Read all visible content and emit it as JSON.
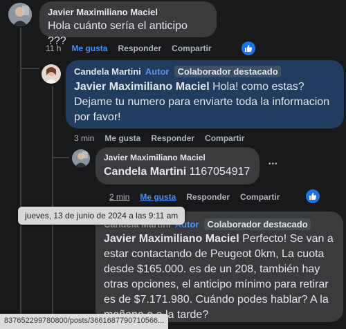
{
  "comments": [
    {
      "author": "Javier Maximiliano Maciel",
      "text": "Hola cuánto sería el anticipo ???",
      "time": "11 h",
      "like": "Me gusta",
      "reply": "Responder",
      "share": "Compartir"
    },
    {
      "author": "Candela Martini",
      "author_badge": "Autor",
      "collab_badge": "Colaborador destacado",
      "mention": "Javier Maximiliano Maciel",
      "text": " Hola! como estas? Dejame tu numero para enviarte toda la informacion por favor!",
      "time": "3 min",
      "like": "Me gusta",
      "reply": "Responder",
      "share": "Compartir"
    },
    {
      "author": "Javier Maximiliano Maciel",
      "mention": "Candela Martini",
      "text": " 1167054917",
      "more": "•••",
      "time": "2 min",
      "like": "Me gusta",
      "reply": "Responder",
      "share": "Compartir"
    },
    {
      "author": "Candela Martini",
      "author_badge": "Autor",
      "collab_badge": "Colaborador destacado",
      "mention": "Javier Maximiliano Maciel",
      "text": " Perfecto! Se van a estar contactando de Peugeot 0km, La cuota desde $165.000. es de un 208, también hay otras opciones, el anticipo mínimo para retirar es de $7.171.980. Cuándo podes hablar? A la mañana o a la tarde?"
    }
  ],
  "tooltip": "jueves, 13 de junio de 2024 a las 9:11 am",
  "status_url": "837652299780800/posts/3661687790710566...",
  "colors": {
    "bg": "#18191a",
    "bubble": "#3a3b3c",
    "author_bubble": "#213c5f",
    "link": "#4a8ef8",
    "like": "#1b74e4"
  },
  "icons": {
    "like": "thumbs-up-icon",
    "more": "more-options-icon"
  }
}
